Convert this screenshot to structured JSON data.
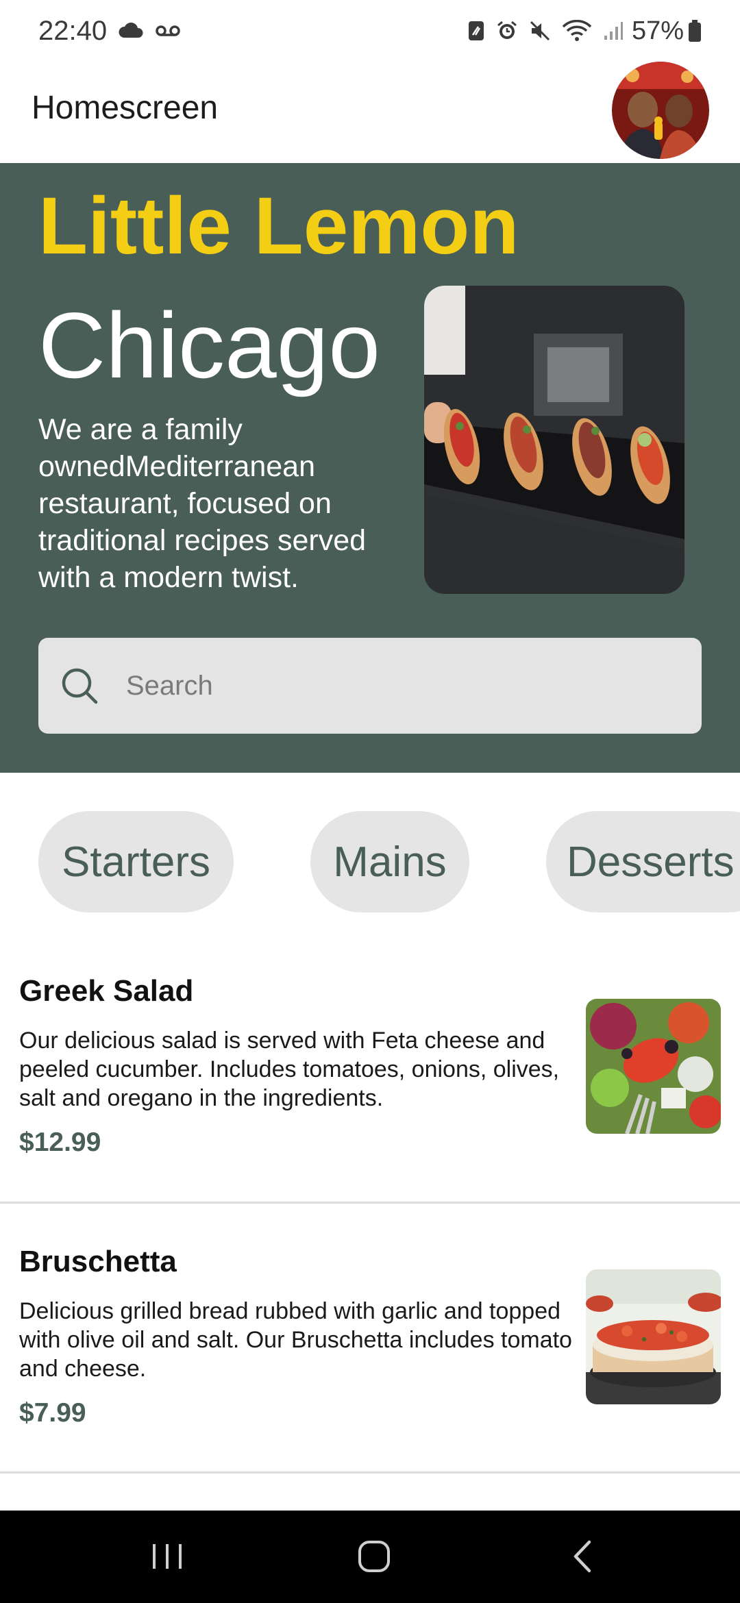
{
  "status_bar": {
    "time": "22:40",
    "battery": "57%",
    "icons": [
      "cloud-icon",
      "voicemail-icon",
      "nfc-icon",
      "alarm-icon",
      "mute-icon",
      "wifi-icon",
      "signal-icon",
      "battery-icon"
    ]
  },
  "app_bar": {
    "title": "Homescreen",
    "avatar": "profile-photo"
  },
  "hero": {
    "title": "Little Lemon",
    "subtitle": "Chicago",
    "description": "We are a family ownedMediterranean restaurant, focused on traditional recipes served with a modern twist.",
    "image": "bruschetta-platter-photo"
  },
  "search": {
    "placeholder": "Search",
    "value": ""
  },
  "categories": [
    {
      "label": "Starters"
    },
    {
      "label": "Mains"
    },
    {
      "label": "Desserts"
    }
  ],
  "menu": [
    {
      "name": "Greek Salad",
      "description": "Our delicious salad is served with Feta cheese and peeled cucumber. Includes tomatoes, onions, olives, salt and oregano in the ingredients.",
      "price": "$12.99",
      "image": "greek-salad-photo"
    },
    {
      "name": "Bruschetta",
      "description": "Delicious grilled bread rubbed with garlic and topped with olive oil and salt. Our Bruschetta includes tomato and cheese.",
      "price": "$7.99",
      "image": "bruschetta-photo"
    }
  ],
  "colors": {
    "primary_green": "#495e57",
    "primary_yellow": "#f4ce14",
    "chip_bg": "#e5e5e5",
    "search_bg": "#e4e4e4"
  }
}
